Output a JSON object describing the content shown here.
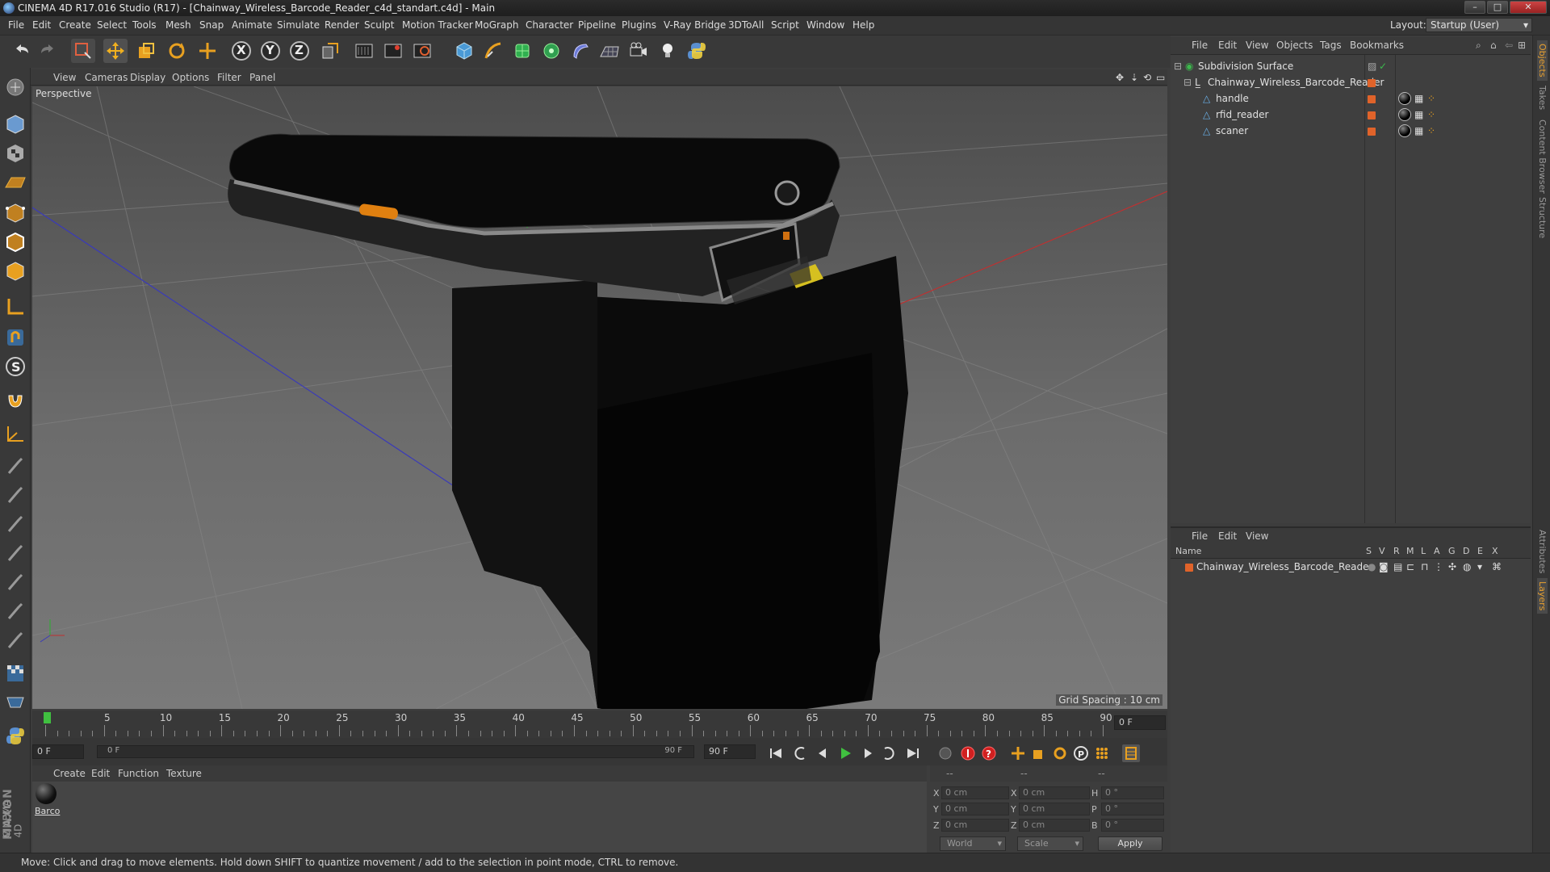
{
  "window": {
    "title": "CINEMA 4D R17.016 Studio (R17) - [Chainway_Wireless_Barcode_Reader_c4d_standart.c4d] - Main",
    "controls": [
      "–",
      "□",
      "✕"
    ]
  },
  "menu": {
    "items": [
      "File",
      "Edit",
      "Create",
      "Select",
      "Tools",
      "Mesh",
      "Snap",
      "Animate",
      "Simulate",
      "Render",
      "Sculpt",
      "Motion Tracker",
      "MoGraph",
      "Character",
      "Pipeline",
      "Plugins",
      "V-Ray Bridge",
      "3DToAll",
      "Script",
      "Window",
      "Help"
    ],
    "layout_label": "Layout:",
    "layout_value": "Startup (User)"
  },
  "toolbar": {
    "icons": [
      "undo-icon",
      "redo-icon",
      "live-selection-icon",
      "move-icon",
      "scale-icon",
      "rotate-icon",
      "recent-tool-icon",
      "x-axis-icon",
      "y-axis-icon",
      "z-axis-icon",
      "coordinate-system-icon",
      "render-view-icon",
      "render-picture-viewer-icon",
      "edit-render-settings-icon",
      "cube-icon",
      "pen-icon",
      "subdivision-icon",
      "cloner-icon",
      "deformer-icon",
      "floor-icon",
      "camera-icon",
      "light-icon",
      "python-icon"
    ],
    "axis_x": "X",
    "axis_y": "Y",
    "axis_z": "Z"
  },
  "viewport": {
    "menu": [
      "View",
      "Cameras",
      "Display",
      "Options",
      "Filter",
      "Panel"
    ],
    "label": "Perspective",
    "grid_spacing": "Grid Spacing : 10 cm"
  },
  "timeline": {
    "ticks": [
      0,
      5,
      10,
      15,
      20,
      25,
      30,
      35,
      40,
      45,
      50,
      55,
      60,
      65,
      70,
      75,
      80,
      85,
      90
    ],
    "current_frame_field": "0 F",
    "start_field": "0 F",
    "range_start": "0 F",
    "range_end": "90 F",
    "end_field": "90 F"
  },
  "material_manager": {
    "menu": [
      "Create",
      "Edit",
      "Function",
      "Texture"
    ],
    "materials": [
      {
        "name": "Barco"
      }
    ]
  },
  "coordinates": {
    "header": [
      "--",
      "--",
      "--"
    ],
    "rows": [
      {
        "a": "X",
        "av": "0 cm",
        "b": "X",
        "bv": "0 cm",
        "c": "H",
        "cv": "0 °"
      },
      {
        "a": "Y",
        "av": "0 cm",
        "b": "Y",
        "bv": "0 cm",
        "c": "P",
        "cv": "0 °"
      },
      {
        "a": "Z",
        "av": "0 cm",
        "b": "Z",
        "bv": "0 cm",
        "c": "B",
        "cv": "0 °"
      }
    ],
    "space": "World",
    "mode": "Scale",
    "apply": "Apply"
  },
  "object_manager": {
    "menu": [
      "File",
      "Edit",
      "View",
      "Objects",
      "Tags",
      "Bookmarks"
    ],
    "objects": [
      {
        "name": "Subdivision Surface",
        "level": 0
      },
      {
        "name": "Chainway_Wireless_Barcode_Reader",
        "level": 1
      },
      {
        "name": "handle",
        "level": 2
      },
      {
        "name": "rfid_reader",
        "level": 2
      },
      {
        "name": "scaner",
        "level": 2
      }
    ]
  },
  "layer_manager": {
    "menu": [
      "File",
      "Edit",
      "View"
    ],
    "columns": [
      "Name",
      "S",
      "V",
      "R",
      "M",
      "L",
      "A",
      "G",
      "D",
      "E",
      "X"
    ],
    "layers": [
      {
        "name": "Chainway_Wireless_Barcode_Reader"
      }
    ]
  },
  "right_tabs": [
    "Objects",
    "Takes",
    "Content Browser",
    "Structure",
    "Attributes",
    "Layers"
  ],
  "brand": {
    "line1": "MAXON",
    "line2": "CINEMA 4D"
  },
  "status": "Move: Click and drag to move elements. Hold down SHIFT to quantize movement / add to the selection in point mode, CTRL to remove.",
  "colors": {
    "accent": "#e8a030",
    "object_orange": "#e0632a",
    "viewport_bg": "#5e5e5e"
  }
}
